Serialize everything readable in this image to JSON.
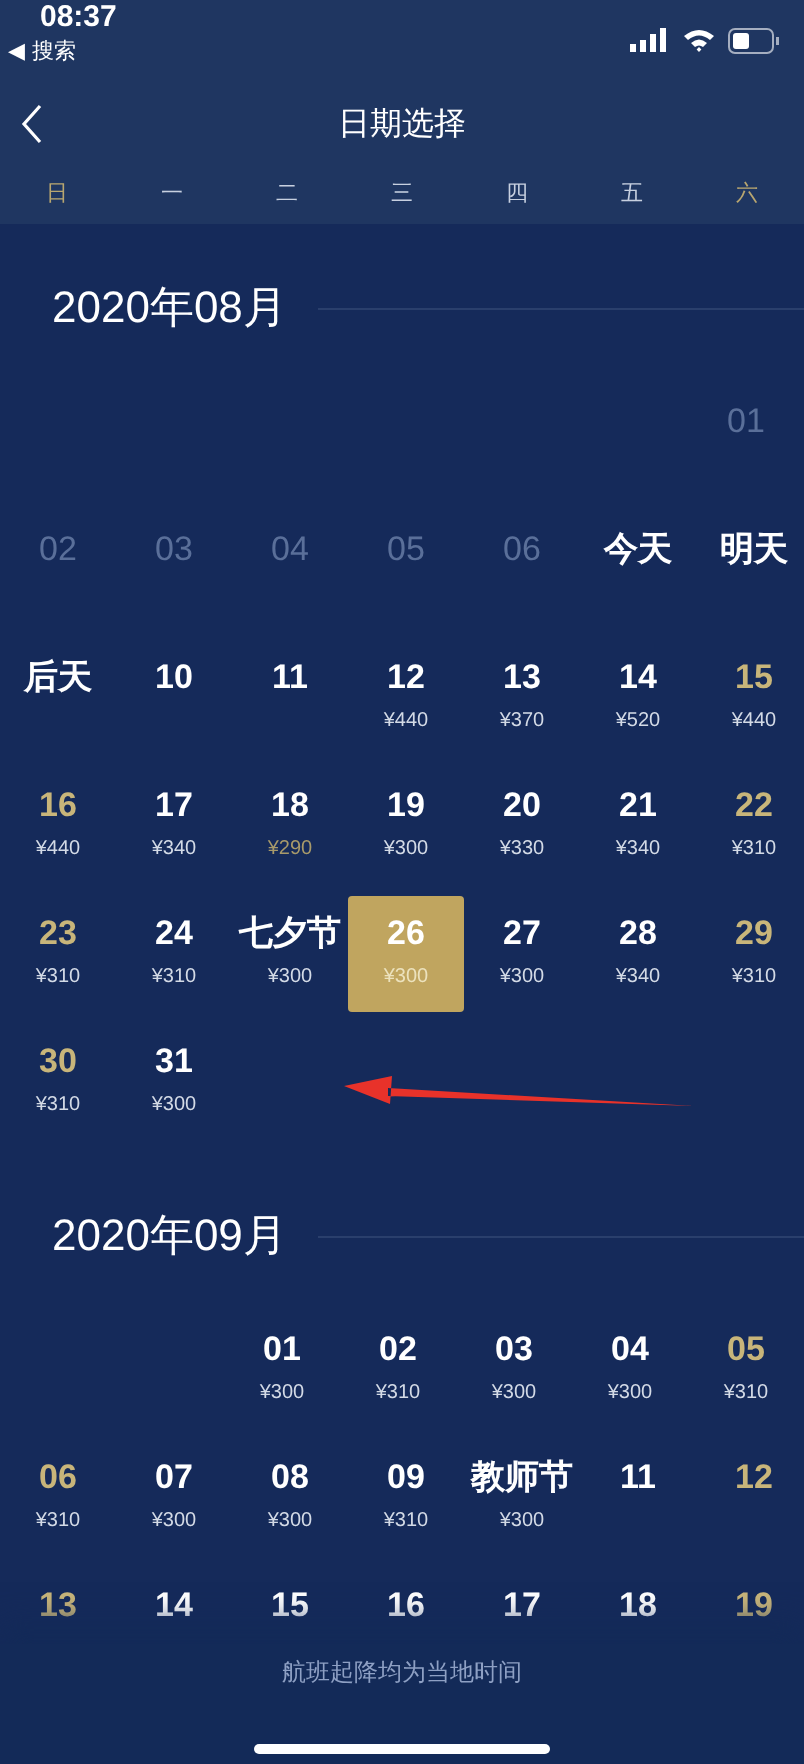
{
  "status_bar": {
    "time": "08:37",
    "back_app": "◀ 搜索"
  },
  "header": {
    "title": "日期选择"
  },
  "weekdays": [
    {
      "label": "日",
      "weekend": true
    },
    {
      "label": "一",
      "weekend": false
    },
    {
      "label": "二",
      "weekend": false
    },
    {
      "label": "三",
      "weekend": false
    },
    {
      "label": "四",
      "weekend": false
    },
    {
      "label": "五",
      "weekend": false
    },
    {
      "label": "六",
      "weekend": true
    }
  ],
  "months": [
    {
      "title": "2020年08月",
      "weeks": [
        [
          {
            "kind": "empty"
          },
          {
            "kind": "empty"
          },
          {
            "kind": "empty"
          },
          {
            "kind": "empty"
          },
          {
            "kind": "empty"
          },
          {
            "kind": "empty"
          },
          {
            "label": "01",
            "kind": "past",
            "selected": false
          }
        ],
        [
          {
            "label": "02",
            "kind": "past",
            "selected": false
          },
          {
            "label": "03",
            "kind": "past",
            "selected": false
          },
          {
            "label": "04",
            "kind": "past",
            "selected": false
          },
          {
            "label": "05",
            "kind": "past",
            "selected": false
          },
          {
            "label": "06",
            "kind": "past",
            "selected": false
          },
          {
            "label": "今天",
            "kind": "day",
            "selected": false
          },
          {
            "label": "明天",
            "kind": "day",
            "selected": false
          }
        ],
        [
          {
            "label": "后天",
            "kind": "day",
            "selected": false
          },
          {
            "label": "10",
            "kind": "day",
            "selected": false
          },
          {
            "label": "11",
            "kind": "day",
            "selected": false
          },
          {
            "label": "12",
            "price": "¥440",
            "kind": "day",
            "selected": false,
            "lowest": false
          },
          {
            "label": "13",
            "price": "¥370",
            "kind": "day",
            "selected": false,
            "lowest": false
          },
          {
            "label": "14",
            "price": "¥520",
            "kind": "day",
            "selected": false,
            "lowest": false
          },
          {
            "label": "15",
            "price": "¥440",
            "kind": "weekend",
            "selected": false,
            "lowest": false
          }
        ],
        [
          {
            "label": "16",
            "price": "¥440",
            "kind": "weekend",
            "selected": false,
            "lowest": false
          },
          {
            "label": "17",
            "price": "¥340",
            "kind": "day",
            "selected": false,
            "lowest": false
          },
          {
            "label": "18",
            "price": "¥290",
            "kind": "day",
            "selected": false,
            "lowest": true
          },
          {
            "label": "19",
            "price": "¥300",
            "kind": "day",
            "selected": false,
            "lowest": false
          },
          {
            "label": "20",
            "price": "¥330",
            "kind": "day",
            "selected": false,
            "lowest": false
          },
          {
            "label": "21",
            "price": "¥340",
            "kind": "day",
            "selected": false,
            "lowest": false
          },
          {
            "label": "22",
            "price": "¥310",
            "kind": "weekend",
            "selected": false,
            "lowest": false
          }
        ],
        [
          {
            "label": "23",
            "price": "¥310",
            "kind": "weekend",
            "selected": false,
            "lowest": false
          },
          {
            "label": "24",
            "price": "¥310",
            "kind": "day",
            "selected": false,
            "lowest": false
          },
          {
            "label": "七夕节",
            "price": "¥300",
            "kind": "day",
            "selected": false,
            "lowest": false
          },
          {
            "label": "26",
            "price": "¥300",
            "kind": "day",
            "selected": true,
            "lowest": false
          },
          {
            "label": "27",
            "price": "¥300",
            "kind": "day",
            "selected": false,
            "lowest": false
          },
          {
            "label": "28",
            "price": "¥340",
            "kind": "day",
            "selected": false,
            "lowest": false
          },
          {
            "label": "29",
            "price": "¥310",
            "kind": "weekend",
            "selected": false,
            "lowest": false
          }
        ],
        [
          {
            "label": "30",
            "price": "¥310",
            "kind": "weekend",
            "selected": false,
            "lowest": false
          },
          {
            "label": "31",
            "price": "¥300",
            "kind": "day",
            "selected": false,
            "lowest": false
          },
          {
            "kind": "empty"
          },
          {
            "kind": "empty"
          },
          {
            "kind": "empty"
          },
          {
            "kind": "empty"
          },
          {
            "kind": "empty"
          }
        ]
      ]
    },
    {
      "title": "2020年09月",
      "weeks": [
        [
          {
            "kind": "empty"
          },
          {
            "kind": "empty"
          },
          {
            "label": "01",
            "price": "¥300",
            "kind": "day",
            "selected": false,
            "lowest": false
          },
          {
            "label": "02",
            "price": "¥310",
            "kind": "day",
            "selected": false,
            "lowest": false
          },
          {
            "label": "03",
            "price": "¥300",
            "kind": "day",
            "selected": false,
            "lowest": false
          },
          {
            "label": "04",
            "price": "¥300",
            "kind": "day",
            "selected": false,
            "lowest": false
          },
          {
            "label": "05",
            "price": "¥310",
            "kind": "weekend",
            "selected": false,
            "lowest": false
          }
        ],
        [
          {
            "label": "06",
            "price": "¥310",
            "kind": "weekend",
            "selected": false,
            "lowest": false
          },
          {
            "label": "07",
            "price": "¥300",
            "kind": "day",
            "selected": false,
            "lowest": false
          },
          {
            "label": "08",
            "price": "¥300",
            "kind": "day",
            "selected": false,
            "lowest": false
          },
          {
            "label": "09",
            "price": "¥310",
            "kind": "day",
            "selected": false,
            "lowest": false
          },
          {
            "label": "教师节",
            "price": "¥300",
            "kind": "day",
            "selected": false,
            "lowest": false
          },
          {
            "label": "11",
            "kind": "day",
            "selected": false
          },
          {
            "label": "12",
            "kind": "weekend",
            "selected": false
          }
        ],
        [
          {
            "label": "13",
            "kind": "weekend",
            "selected": false
          },
          {
            "label": "14",
            "kind": "day",
            "selected": false
          },
          {
            "label": "15",
            "kind": "day",
            "selected": false
          },
          {
            "label": "16",
            "kind": "day",
            "selected": false
          },
          {
            "label": "17",
            "kind": "day",
            "selected": false
          },
          {
            "label": "18",
            "kind": "day",
            "selected": false
          },
          {
            "label": "19",
            "kind": "weekend",
            "selected": false
          }
        ]
      ]
    }
  ],
  "footer": {
    "note": "航班起降均为当地时间"
  }
}
